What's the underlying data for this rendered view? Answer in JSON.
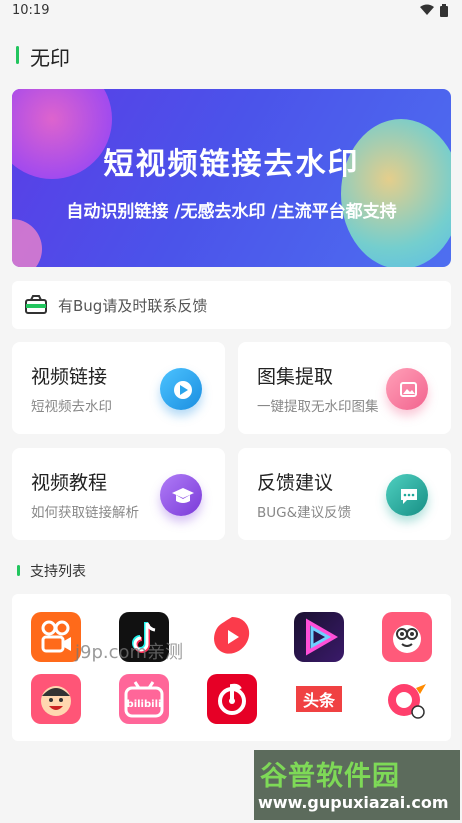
{
  "status": {
    "time": "10:19"
  },
  "header": {
    "title": "无印"
  },
  "banner": {
    "title": "短视频链接去水印",
    "subtitle": "自动识别链接 /无感去水印 /主流平台都支持"
  },
  "notice": {
    "text": "有Bug请及时联系反馈"
  },
  "cards": [
    {
      "title": "视频链接",
      "subtitle": "短视频去水印",
      "icon": "play-icon",
      "color": "#2aa5ec"
    },
    {
      "title": "图集提取",
      "subtitle": "一键提取无水印图集",
      "icon": "image-icon",
      "color": "#f2638e"
    },
    {
      "title": "视频教程",
      "subtitle": "如何获取链接解析",
      "icon": "graduation-cap-icon",
      "color": "#8a4fe0"
    },
    {
      "title": "反馈建议",
      "subtitle": "BUG&建议反馈",
      "icon": "chat-bubble-icon",
      "color": "#20a89a"
    }
  ],
  "support": {
    "title": "支持列表",
    "apps": [
      "kuaishou-app-icon",
      "douyin-app-icon",
      "weishi-app-icon",
      "video-app-icon",
      "pipixia-app-icon",
      "face-app-icon",
      "bilibili-app-icon",
      "netease-music-app-icon",
      "toutiao-app-icon",
      "bird-app-icon"
    ],
    "toutiao_label": "头条",
    "bilibili_label": "bilibili"
  },
  "watermarks": {
    "site_label": "j9p.com亲测",
    "brand": "谷普软件园",
    "url": "www.gupuxiazai.com"
  }
}
